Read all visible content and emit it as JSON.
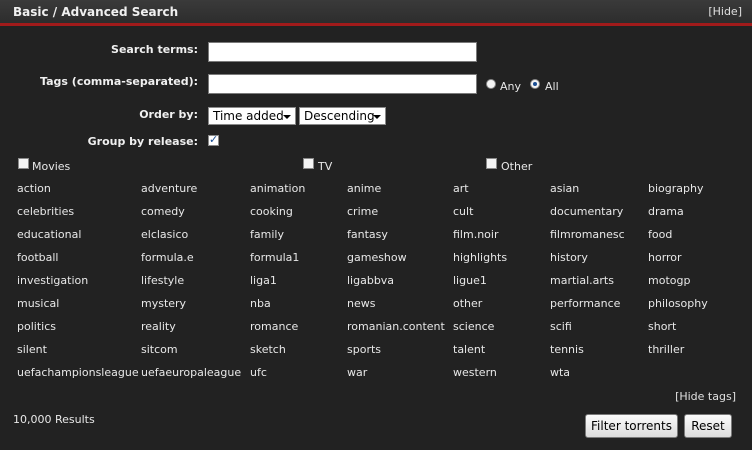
{
  "header": {
    "title": "Basic / Advanced Search",
    "hide_link": "[Hide]"
  },
  "form": {
    "search_terms_label": "Search terms:",
    "search_terms_value": "",
    "tags_label": "Tags (comma-separated):",
    "tags_value": "",
    "tag_mode_any": "Any",
    "tag_mode_all": "All",
    "tag_mode_selected": "All",
    "order_by_label": "Order by:",
    "order_by_value": "Time added",
    "order_dir_value": "Descending",
    "group_label": "Group by release:",
    "group_checked": true
  },
  "categories": [
    {
      "label": "Movies",
      "checked": false
    },
    {
      "label": "TV",
      "checked": false
    },
    {
      "label": "Other",
      "checked": false
    }
  ],
  "tags": [
    [
      "action",
      "adventure",
      "animation",
      "anime",
      "art",
      "asian",
      "biography"
    ],
    [
      "celebrities",
      "comedy",
      "cooking",
      "crime",
      "cult",
      "documentary",
      "drama"
    ],
    [
      "educational",
      "elclasico",
      "family",
      "fantasy",
      "film.noir",
      "filmromanesc",
      "food"
    ],
    [
      "football",
      "formula.e",
      "formula1",
      "gameshow",
      "highlights",
      "history",
      "horror"
    ],
    [
      "investigation",
      "lifestyle",
      "liga1",
      "ligabbva",
      "ligue1",
      "martial.arts",
      "motogp"
    ],
    [
      "musical",
      "mystery",
      "nba",
      "news",
      "other",
      "performance",
      "philosophy"
    ],
    [
      "politics",
      "reality",
      "romance",
      "romanian.content",
      "science",
      "scifi",
      "short"
    ],
    [
      "silent",
      "sitcom",
      "sketch",
      "sports",
      "talent",
      "tennis",
      "thriller"
    ],
    [
      "uefachampionsleague",
      "uefaeuropaleague",
      "ufc",
      "war",
      "western",
      "wta",
      ""
    ]
  ],
  "footer": {
    "hide_tags": "[Hide tags]",
    "results": "10,000 Results",
    "filter_button": "Filter torrents",
    "reset_button": "Reset"
  }
}
